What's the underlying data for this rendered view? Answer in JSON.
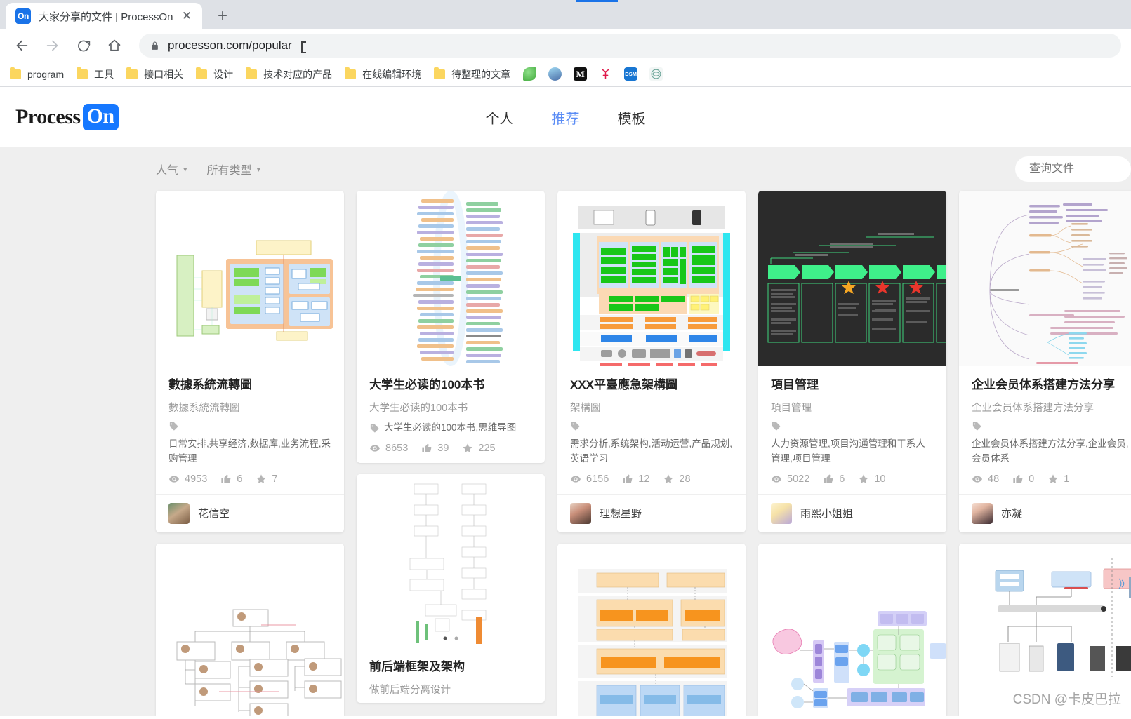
{
  "browser": {
    "tab": {
      "title": "大家分享的文件 | ProcessOn",
      "favicon_text": "On",
      "close_icon": "close-icon"
    },
    "new_tab_label": "+",
    "url": "processon.com/popular",
    "nav": {
      "back": "back-arrow-icon",
      "forward": "forward-arrow-icon",
      "reload": "reload-icon",
      "home": "home-icon"
    },
    "bookmarks": [
      {
        "label": "program",
        "type": "folder"
      },
      {
        "label": "工具",
        "type": "folder"
      },
      {
        "label": "接口相关",
        "type": "folder"
      },
      {
        "label": "设计",
        "type": "folder"
      },
      {
        "label": "技术对应的产品",
        "type": "folder"
      },
      {
        "label": "在线编辑环境",
        "type": "folder"
      },
      {
        "label": "待整理的文章",
        "type": "folder"
      }
    ],
    "bookmark_icons": [
      {
        "name": "leaf-icon",
        "text": "",
        "color": "#4caf50"
      },
      {
        "name": "avatar-icon",
        "text": "",
        "color": "#6ec6f0"
      },
      {
        "name": "medium-icon",
        "text": "M",
        "color": "#111111"
      },
      {
        "name": "antenna-icon",
        "text": "",
        "color": "#ffffff"
      },
      {
        "name": "dsm-icon",
        "text": "DSM",
        "color": "#1876d2"
      },
      {
        "name": "chatgpt-icon",
        "text": "",
        "color": "#10a37f"
      }
    ]
  },
  "site": {
    "logo": {
      "part1": "Process",
      "part2": "On"
    },
    "nav": [
      {
        "label": "个人",
        "active": false
      },
      {
        "label": "推荐",
        "active": true
      },
      {
        "label": "模板",
        "active": false
      }
    ]
  },
  "filters": [
    {
      "label": "人气",
      "chevron": "chevron-down-icon"
    },
    {
      "label": "所有类型",
      "chevron": "chevron-down-icon"
    }
  ],
  "search": {
    "placeholder": "查询文件",
    "value": ""
  },
  "watermark": "CSDN @卡皮巴拉",
  "cards": [
    {
      "id": "card-1",
      "title": "數據系統流轉圖",
      "desc": "數據系統流轉圖",
      "tags": "日常安排,共享经济,数据库,业务流程,采购管理",
      "tags_wrap": true,
      "views": "4953",
      "likes": "6",
      "stars": "7",
      "author": "花信空",
      "thumb": "flow-diagram-orange"
    },
    {
      "id": "card-2",
      "title": "大学生必读的100本书",
      "desc": "大学生必读的100本书",
      "tags": "大学生必读的100本书,思维导图",
      "tags_wrap": false,
      "views": "8653",
      "likes": "39",
      "stars": "225",
      "author": "",
      "thumb": "mindmap-fan"
    },
    {
      "id": "card-3",
      "title": "XXX平臺應急架構圖",
      "desc": "架構圖",
      "tags": "需求分析,系统架构,活动运营,产品规划,英语学习",
      "tags_wrap": true,
      "views": "6156",
      "likes": "12",
      "stars": "28",
      "author": "理想星野",
      "thumb": "platform-arch-green"
    },
    {
      "id": "card-4",
      "title": "項目管理",
      "desc": "項目管理",
      "tags": "人力资源管理,项目沟通管理和干系人管理,项目管理",
      "tags_wrap": true,
      "views": "5022",
      "likes": "6",
      "stars": "10",
      "author": "雨熙小姐姐",
      "thumb": "dark-timeline"
    },
    {
      "id": "card-5",
      "title": "企业会员体系搭建方法分享",
      "desc": "企业会员体系搭建方法分享",
      "tags": "企业会员体系搭建方法分享,企业会员,会员体系",
      "tags_wrap": true,
      "views": "48",
      "likes": "0",
      "stars": "1",
      "author": "亦凝",
      "thumb": "mindmap-tree"
    },
    {
      "id": "card-6",
      "title": "前后端框架及架构",
      "desc": "做前后端分离设计",
      "tags": "",
      "tags_wrap": false,
      "views": "",
      "likes": "",
      "stars": "",
      "author": "",
      "thumb": "frontend-backend"
    }
  ],
  "icons": {
    "eye": "eye-icon",
    "thumbs_up": "thumbs-up-icon",
    "star": "star-icon",
    "tag": "tag-icon"
  }
}
